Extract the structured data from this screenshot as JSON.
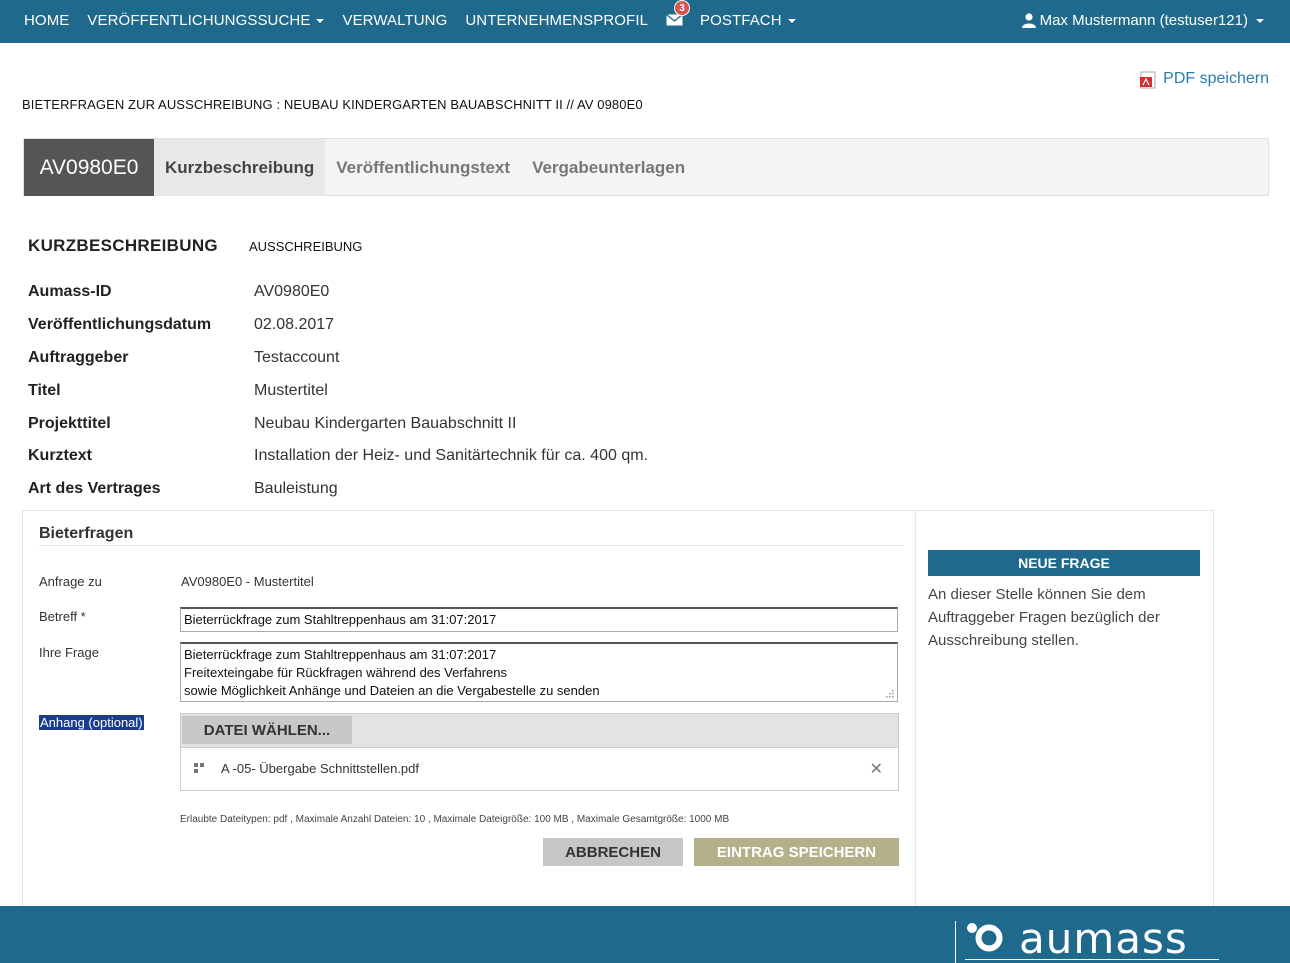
{
  "nav": {
    "home": "HOME",
    "search": "VERÖFFENTLICHUNGSSUCHE",
    "admin": "VERWALTUNG",
    "profile": "UNTERNEHMENSPROFIL",
    "mail_badge": "3",
    "mailbox": "POSTFACH",
    "user": "Max Mustermann (testuser121)"
  },
  "pdf_link": "PDF speichern",
  "page_heading": "BIETERFRAGEN ZUR AUSSCHREIBUNG : NEUBAU KINDERGARTEN BAUABSCHNITT II // AV 0980E0",
  "tabs": {
    "id": "AV0980E0",
    "items": [
      "Kurzbeschreibung",
      "Veröffentlichungstext",
      "Vergabeunterlagen"
    ]
  },
  "summary": {
    "heading": "KURZBESCHREIBUNG",
    "subheading": "AUSSCHREIBUNG",
    "rows": [
      {
        "label": "Aumass-ID",
        "value": "AV0980E0"
      },
      {
        "label": "Veröffentlichungsdatum",
        "value": "02.08.2017"
      },
      {
        "label": "Auftraggeber",
        "value": "Testaccount"
      },
      {
        "label": "Titel",
        "value": "Mustertitel"
      },
      {
        "label": "Projekttitel",
        "value": "Neubau Kindergarten Bauabschnitt II"
      },
      {
        "label": "Kurztext",
        "value": "Installation der Heiz- und Sanitärtechnik für ca. 400 qm."
      },
      {
        "label": "Art des Vertrages",
        "value": "Bauleistung"
      }
    ]
  },
  "bieterfragen": {
    "title": "Bieterfragen",
    "anfrage_label": "Anfrage zu",
    "anfrage_value": "AV0980E0 - Mustertitel",
    "betreff_label": "Betreff *",
    "betreff_value": "Bieterrückfrage zum Stahltreppenhaus am 31:07:2017",
    "frage_label": "Ihre Frage",
    "frage_lines": [
      "Bieterrückfrage zum Stahltreppenhaus am 31:07:2017",
      "Freitexteingabe für Rückfragen während des Verfahrens",
      "sowie Möglichkeit Anhänge und Dateien an die Vergabestelle zu senden"
    ],
    "anhang_label": "Anhang (optional)",
    "file_button": "DATEI WÄHLEN...",
    "file_name": "A -05- Übergabe Schnittstellen.pdf",
    "hint": "Erlaubte Dateitypen: pdf , Maximale Anzahl Dateien: 10 , Maximale Dateigröße: 100 MB , Maximale Gesamtgröße: 1000 MB",
    "cancel": "ABBRECHEN",
    "save": "EINTRAG SPEICHERN"
  },
  "new_question": {
    "header": "NEUE FRAGE",
    "text": "An dieser Stelle können Sie dem Auftraggeber Fragen bezüglich der Ausschreibung stellen."
  },
  "footer": {
    "logo_text": "aumass"
  },
  "colors": {
    "brand": "#1f6a8c",
    "save_button": "#b3b08a",
    "cancel_button": "#c6c6c6",
    "tab_id_bg": "#555555",
    "badge": "#d9534f",
    "link": "#2a7ab0"
  }
}
